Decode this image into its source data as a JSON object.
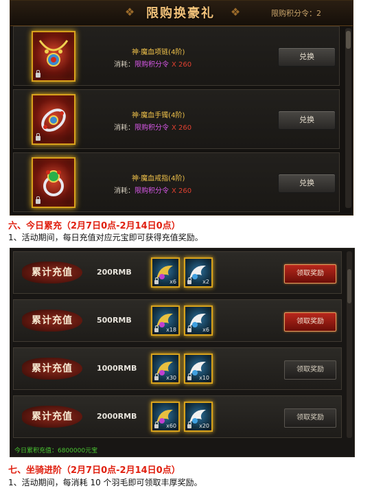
{
  "exchange": {
    "title": "限购换豪礼",
    "points_text": "限购积分令：2",
    "cost_label": "消耗：",
    "items": [
      {
        "name": "神·魔血项链(4阶)",
        "cost_token": "限购积分令",
        "cost_amount": "X 260",
        "button": "兑换",
        "icon": "necklace-icon"
      },
      {
        "name": "神·魔血手镯(4阶)",
        "cost_token": "限购积分令",
        "cost_amount": "X 260",
        "button": "兑换",
        "icon": "bracelet-icon"
      },
      {
        "name": "神·魔血戒指(4阶)",
        "cost_token": "限购积分令",
        "cost_amount": "X 260",
        "button": "兑换",
        "icon": "ring-icon"
      }
    ]
  },
  "section6": {
    "title": "六、今日累充（2月7日0点-2月14日0点）",
    "desc": "1、活动期间，每日充值对应元宝即可获得充值奖励。"
  },
  "recharge": {
    "rows": [
      {
        "label": "累计充值",
        "amount": "200RMB",
        "reward1": "x6",
        "reward2": "x2",
        "button": "领取奖励",
        "button_state": "active"
      },
      {
        "label": "累计充值",
        "amount": "500RMB",
        "reward1": "x18",
        "reward2": "x6",
        "button": "领取奖励",
        "button_state": "active"
      },
      {
        "label": "累计充值",
        "amount": "1000RMB",
        "reward1": "x30",
        "reward2": "x10",
        "button": "领取奖励",
        "button_state": "inactive"
      },
      {
        "label": "累计充值",
        "amount": "2000RMB",
        "reward1": "x60",
        "reward2": "x20",
        "button": "领取奖励",
        "button_state": "inactive"
      }
    ],
    "total_text": "今日累积充值：6800000元宝"
  },
  "section7": {
    "title": "七、坐骑进阶（2月7日0点-2月14日0点）",
    "desc": "1、活动期间，每消耗 10 个羽毛即可领取丰厚奖励。"
  },
  "colors": {
    "gold": "#f0c24a",
    "magenta": "#d858e8",
    "red": "#e02010",
    "green": "#4ac832"
  }
}
